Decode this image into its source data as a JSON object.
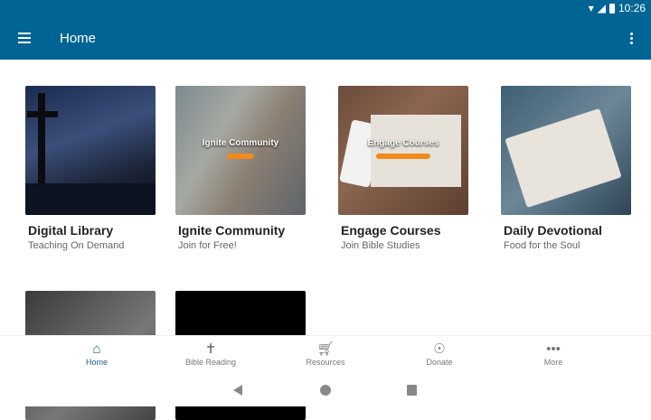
{
  "status": {
    "time": "10:26",
    "icons": [
      "wifi-icon",
      "signal-icon",
      "battery-icon"
    ]
  },
  "appbar": {
    "title": "Home",
    "color": "#006494"
  },
  "cards": [
    {
      "title": "Digital Library",
      "subtitle": "Teaching On Demand"
    },
    {
      "title": "Ignite Community",
      "subtitle": "Join for Free!",
      "overlay": "Ignite Community"
    },
    {
      "title": "Engage Courses",
      "subtitle": "Join Bible Studies",
      "overlay": "Engage Courses"
    },
    {
      "title": "Daily Devotional",
      "subtitle": "Food for the Soul"
    }
  ],
  "bottom_nav": [
    {
      "label": "Home",
      "icon": "home-icon",
      "active": true
    },
    {
      "label": "Bible Reading",
      "icon": "bible-icon"
    },
    {
      "label": "Resources",
      "icon": "cart-icon"
    },
    {
      "label": "Donate",
      "icon": "donate-icon"
    },
    {
      "label": "More",
      "icon": "more-icon"
    }
  ],
  "accent": "#1a5e8a"
}
